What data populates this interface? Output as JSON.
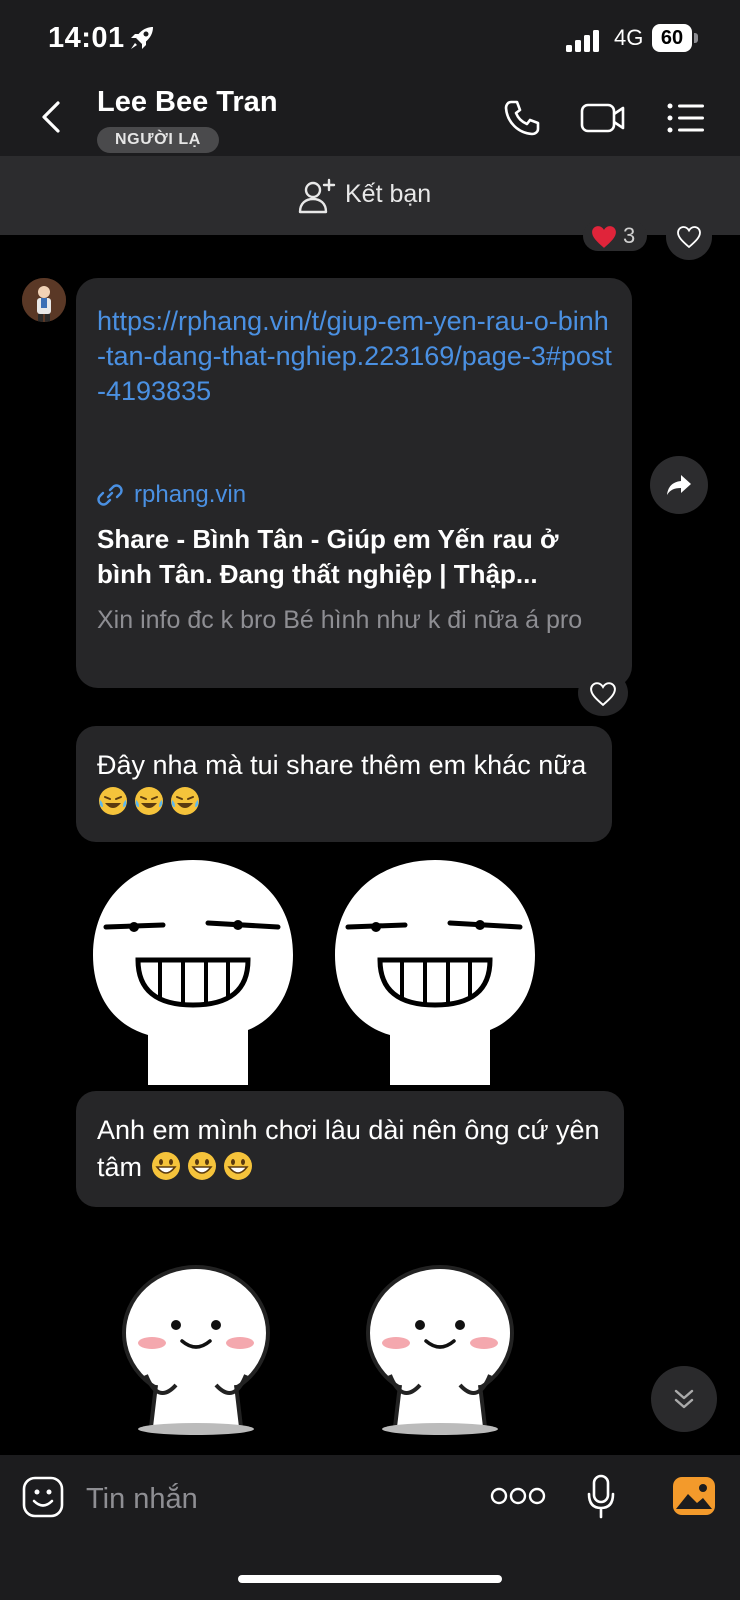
{
  "status_bar": {
    "time": "14:01",
    "network": "4G",
    "battery": "60"
  },
  "header": {
    "contact_name": "Lee Bee Tran",
    "badge": "NGƯỜI LẠ"
  },
  "add_friend": {
    "label": "Kết bạn"
  },
  "previous_message": {
    "reaction_count": "3"
  },
  "link_message": {
    "url": "https://rphang.vin/t/giup-em-yen-rau-o-binh-tan-dang-that-nghiep.223169/page-3#post-4193835",
    "domain": "rphang.vin",
    "title": "Share - Bình Tân - Giúp em Yến rau ở bình Tân. Đang thất nghiệp | Thập...",
    "description": "Xin info đc k bro Bé hình như k đi nữa á pro"
  },
  "message_2": {
    "text": "Đây nha mà tui share thêm em khác nữa"
  },
  "message_3": {
    "text": "Anh em mình chơi lâu dài nên ông cứ yên tâm"
  },
  "input": {
    "placeholder": "Tin nhắn"
  },
  "colors": {
    "link": "#4a90e2",
    "bubble": "#262628",
    "header": "#1c1c1e",
    "reaction": "#e0243a",
    "gallery": "#f39a2b"
  },
  "icons": [
    "rocket-icon",
    "signal-icon",
    "battery-icon",
    "back-icon",
    "phone-icon",
    "video-icon",
    "menu-icon",
    "add-friend-icon",
    "heart-icon",
    "chain-link-icon",
    "forward-icon",
    "laugh-emoji-icon",
    "grin-emoji-icon",
    "chevron-double-down-icon",
    "sticker-icon",
    "more-icon",
    "mic-icon",
    "gallery-icon"
  ]
}
